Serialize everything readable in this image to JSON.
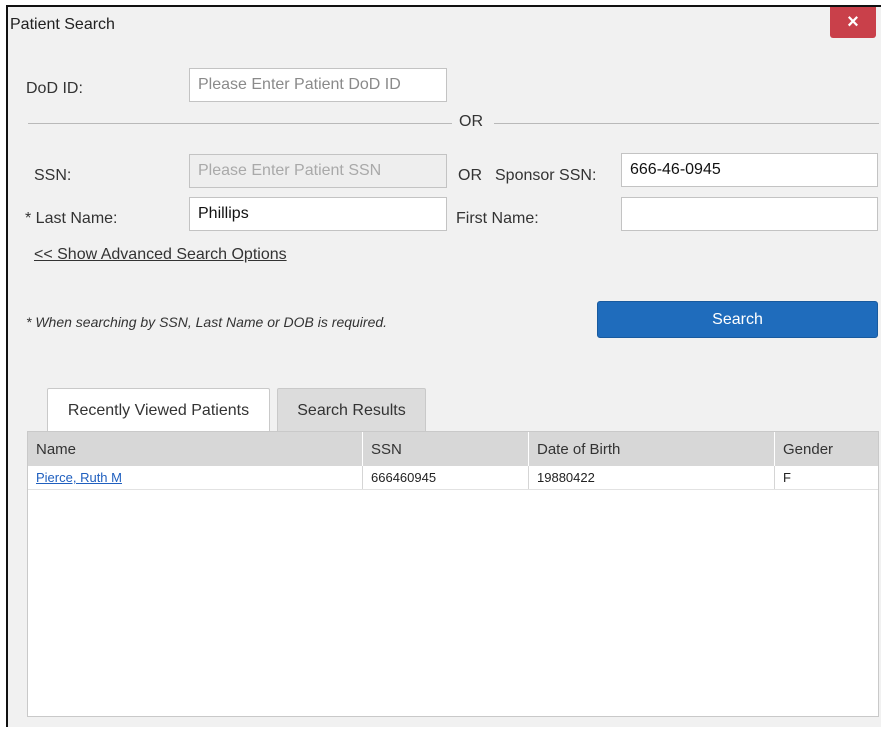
{
  "dialog": {
    "title": "Patient Search",
    "close_label": "×"
  },
  "form": {
    "dod_label": "DoD ID:",
    "dod_placeholder": "Please Enter Patient DoD ID",
    "dod_value": "",
    "or_divider": "OR",
    "ssn_label": "SSN:",
    "ssn_placeholder": "Please Enter Patient SSN",
    "ssn_value": "",
    "or_inline": "OR",
    "sponsor_ssn_label": "Sponsor SSN:",
    "sponsor_ssn_value": "666-46-0945",
    "last_name_label": "* Last Name:",
    "last_name_value": "Phillips",
    "first_name_label": "First Name:",
    "first_name_value": "",
    "advanced_link": "<< Show Advanced Search Options",
    "note": "* When searching by SSN, Last Name or DOB is required.",
    "search_button": "Search"
  },
  "tabs": [
    {
      "label": "Recently Viewed Patients",
      "active": false
    },
    {
      "label": "Search Results",
      "active": true
    }
  ],
  "results": {
    "columns": [
      "Name",
      "SSN",
      "Date of Birth",
      "Gender"
    ],
    "rows": [
      {
        "name": "Pierce, Ruth M",
        "ssn": "666460945",
        "dob": "19880422",
        "gender": "F"
      }
    ]
  },
  "colors": {
    "primary_button": "#1f6cbc",
    "close_button": "#c9404a",
    "link": "#1f5fbf"
  }
}
